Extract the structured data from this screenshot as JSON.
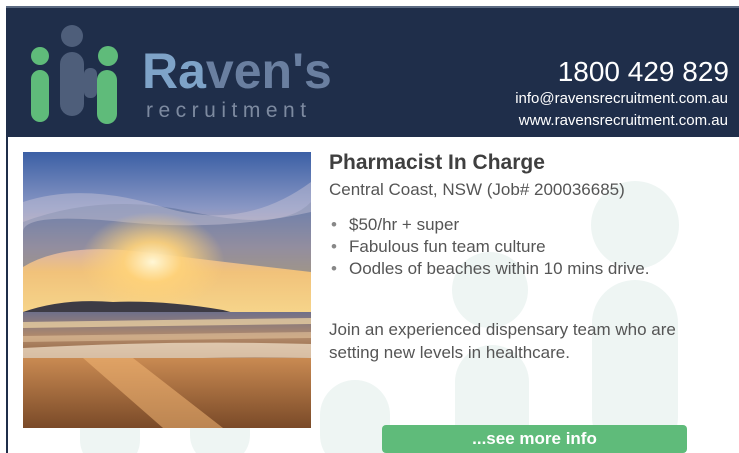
{
  "brand": {
    "name": "Raven's",
    "tagline": "recruitment",
    "phone": "1800 429 829",
    "email": "info@ravensrecruitment.com.au",
    "website": "www.ravensrecruitment.com.au",
    "colors": {
      "header_bg": "#1f2e4a",
      "accent_green": "#5fbb7a",
      "logo_figure_dark": "#4e5e7a"
    }
  },
  "job": {
    "title": "Pharmacist In Charge",
    "location": "Central Coast, NSW (Job# 200036685)",
    "highlights": [
      "$50/hr + super",
      "Fabulous fun team culture",
      "Oodles of beaches within 10 mins drive."
    ],
    "description": "Join an experienced dispensary team who are setting new levels in healthcare.",
    "cta_label": "...see more info"
  },
  "bullet_glyph": "•"
}
